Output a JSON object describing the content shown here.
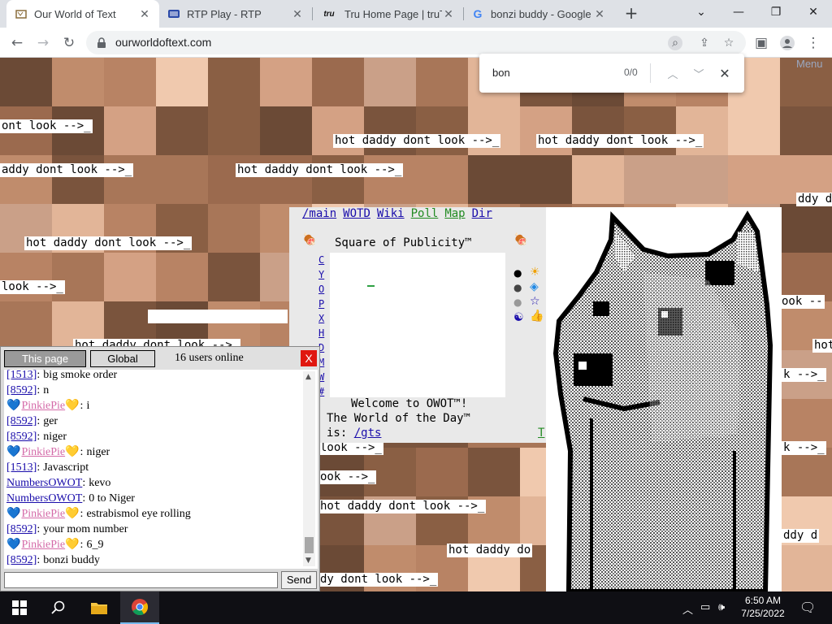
{
  "browser": {
    "tabs": [
      {
        "title": "Our World of Text",
        "favicon": "owot-icon",
        "active": true
      },
      {
        "title": "RTP Play - RTP",
        "favicon": "rtp-icon",
        "active": false
      },
      {
        "title": "Tru Home Page | truTV",
        "favicon": "trutv-icon",
        "favicon_text": "tru",
        "active": false
      },
      {
        "title": "bonzi buddy - Google",
        "favicon": "google-icon",
        "favicon_text": "G",
        "active": false
      }
    ],
    "url": "ourworldoftext.com",
    "new_tab_icon": "+",
    "find": {
      "query": "bon",
      "count": "0/0"
    }
  },
  "page": {
    "menu_label": "Menu",
    "background_texts": [
      "ont look -->_",
      "hot daddy dont look -->_",
      "hot daddy dont look -->_",
      "addy dont look -->_",
      "hot daddy dont look -->_",
      "ddy d",
      "hot daddy dont look -->_",
      "look -->_",
      "ook --",
      "hot daddy dont look -->_",
      "hot",
      "k -->_",
      "look -->_",
      "k -->_",
      "ook -->_",
      "hot daddy dont look -->_",
      "ddy d",
      "hot daddy do",
      "dy dont look -->_"
    ],
    "sop": {
      "links": [
        {
          "label": "/main",
          "color": "blue"
        },
        {
          "label": "WOTD",
          "color": "blue"
        },
        {
          "label": "Wiki",
          "color": "blue"
        },
        {
          "label": "Poll",
          "color": "green"
        },
        {
          "label": "Map",
          "color": "green"
        },
        {
          "label": "Dir",
          "color": "blue"
        }
      ],
      "title": "Square of Publicity™",
      "letters": [
        "C",
        "Y",
        "O",
        "P",
        "X",
        "H",
        "D",
        "M",
        "W",
        "#"
      ],
      "welcome": "Welcome to OWOT™!",
      "wotd_line": "The World of the Day™",
      "is_label": "is: ",
      "wotd_link": "/gts",
      "t_link": "T"
    }
  },
  "chat": {
    "tab_this_page": "This page",
    "tab_global": "Global",
    "online": "16 users online",
    "close_label": "X",
    "send_label": "Send",
    "input_value": "",
    "messages": [
      {
        "nick": "[1513]",
        "text": "big smoke order",
        "style": "id"
      },
      {
        "nick": "[8592]",
        "text": "n",
        "style": "id"
      },
      {
        "nick": "PinkiePie",
        "text": "i",
        "style": "pink"
      },
      {
        "nick": "[8592]",
        "text": "ger",
        "style": "id"
      },
      {
        "nick": "[8592]",
        "text": "niger",
        "style": "id"
      },
      {
        "nick": "PinkiePie",
        "text": "niger",
        "style": "pink"
      },
      {
        "nick": "[1513]",
        "text": "Javascript",
        "style": "id"
      },
      {
        "nick": "NumbersOWOT",
        "text": "kevo",
        "style": "user"
      },
      {
        "nick": "NumbersOWOT",
        "text": "0 to Niger",
        "style": "user"
      },
      {
        "nick": "PinkiePie",
        "text": "estrabismol eye rolling",
        "style": "pink"
      },
      {
        "nick": "[8592]",
        "text": "your mom number",
        "style": "id"
      },
      {
        "nick": "PinkiePie",
        "text": "6_9",
        "style": "pink"
      },
      {
        "nick": "[8592]",
        "text": "bonzi buddy",
        "style": "id"
      }
    ]
  },
  "taskbar": {
    "time": "6:50 AM",
    "date": "7/25/2022"
  },
  "colors": {
    "tab_bg": "#dee1e6",
    "accent_blue": "#1a0dab",
    "pink_nick": "#d46aa8",
    "chat_close": "#e0170f"
  }
}
